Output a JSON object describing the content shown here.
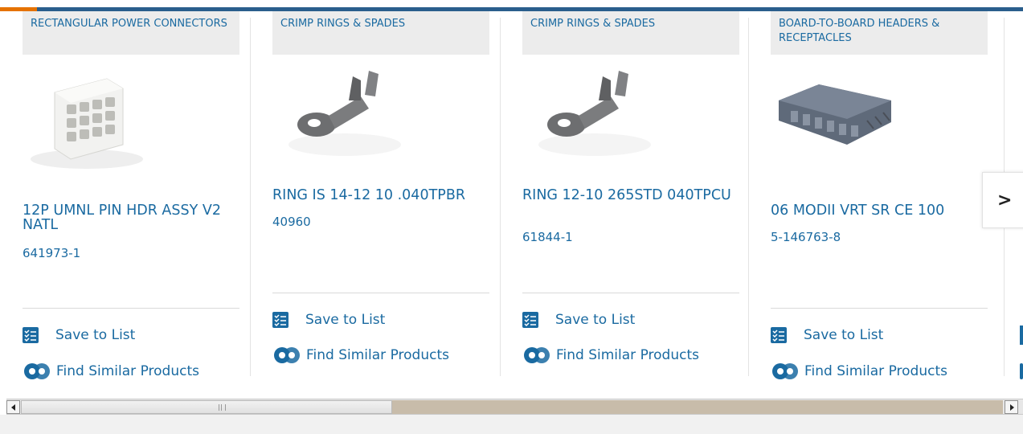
{
  "products": [
    {
      "category": "RECTANGULAR POWER CONNECTORS",
      "title": "12P UMNL PIN HDR ASSY V2 NATL",
      "part_number": "641973-1",
      "image": "white-connector-image",
      "save_label": "Save to List",
      "similar_label": "Find Similar Products"
    },
    {
      "category": "CRIMP RINGS & SPADES",
      "title": "RING IS 14-12 10 .040TPBR",
      "part_number": "40960",
      "image": "ring-terminal-image",
      "save_label": "Save to List",
      "similar_label": "Find Similar Products"
    },
    {
      "category": "CRIMP RINGS & SPADES",
      "title": "RING 12-10 265STD 040TPCU",
      "part_number": "61844-1",
      "image": "ring-terminal-image",
      "save_label": "Save to List",
      "similar_label": "Find Similar Products"
    },
    {
      "category": "BOARD-TO-BOARD HEADERS & RECEPTACLES",
      "title": "06 MODII VRT SR CE 100",
      "part_number": "5-146763-8",
      "image": "receptacle-image",
      "save_label": "Save to List",
      "similar_label": "Find Similar Products"
    }
  ],
  "carousel": {
    "next_glyph": ">",
    "next_icon": "chevron-right-icon"
  },
  "colors": {
    "link": "#1a6aa1",
    "header_bar": "#2a5e8c",
    "accent": "#e57200",
    "category_bg": "#ececec"
  }
}
